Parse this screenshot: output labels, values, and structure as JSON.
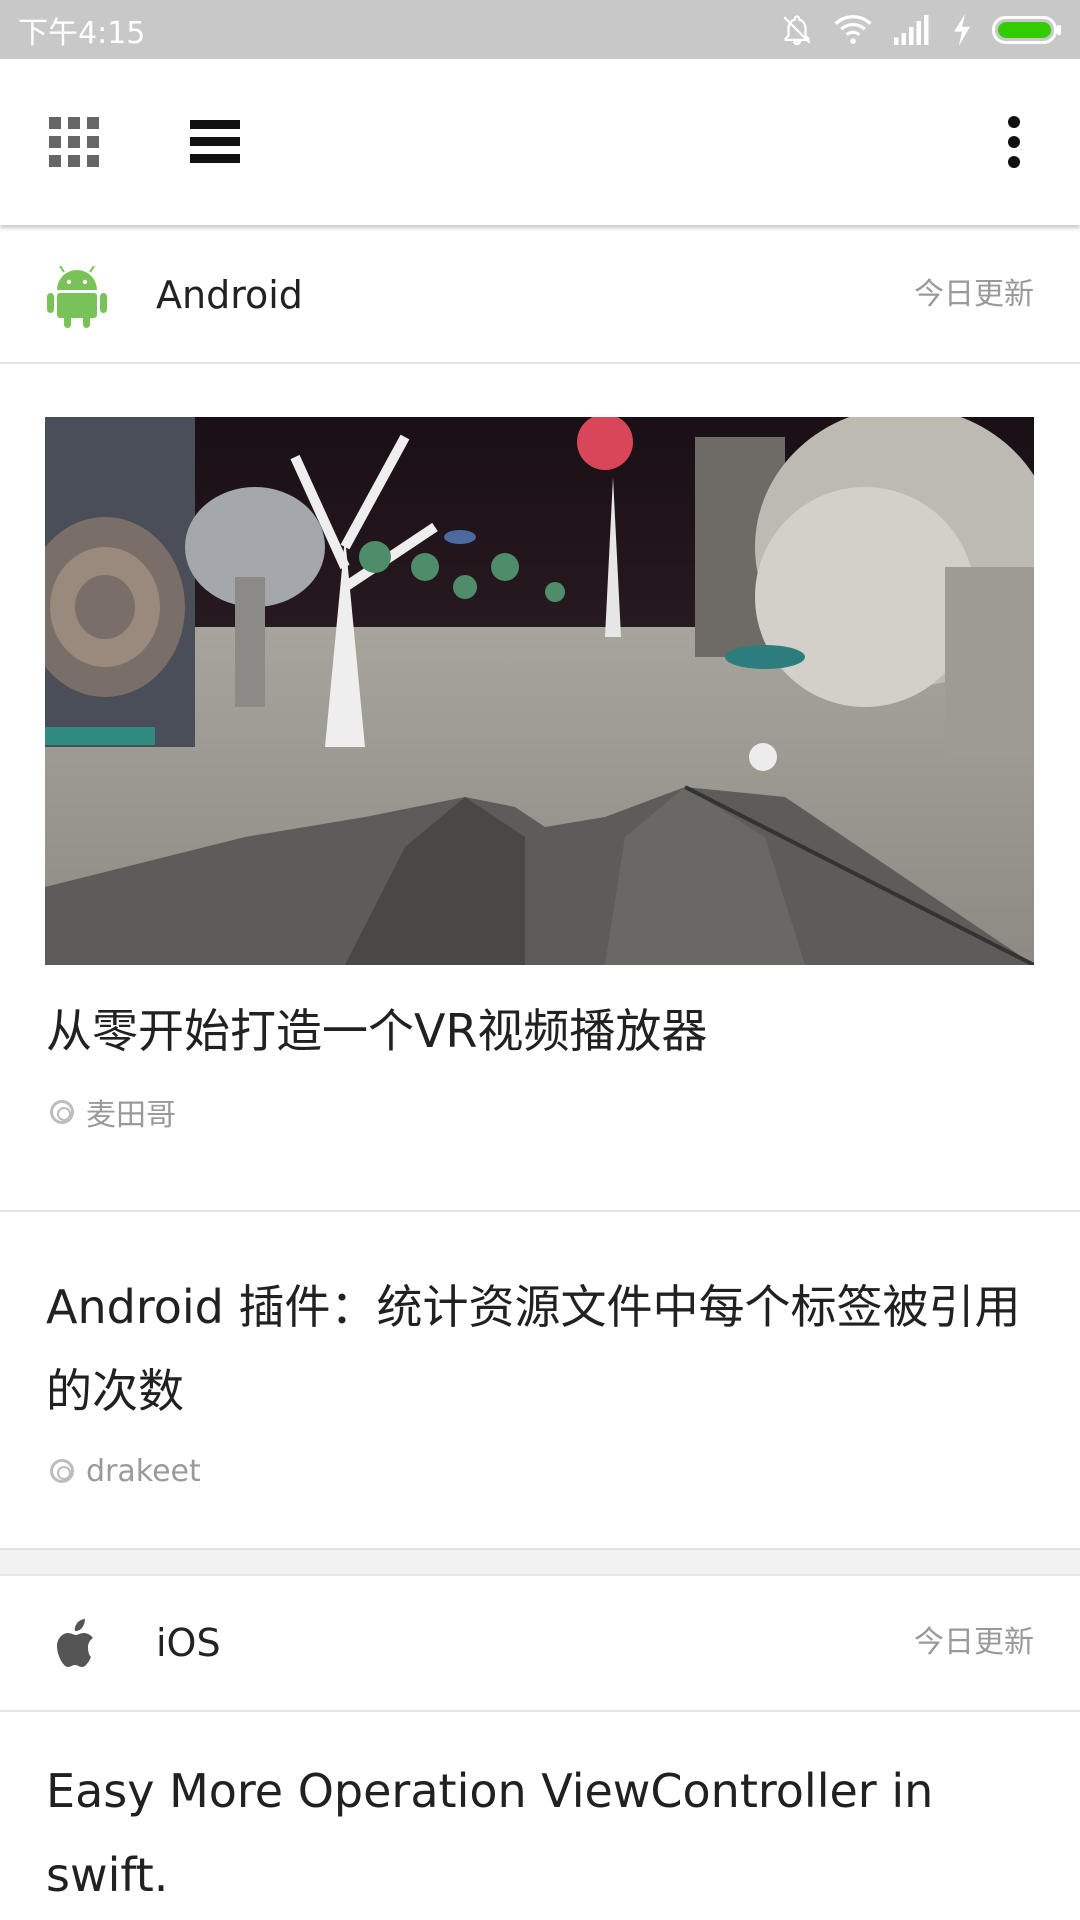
{
  "status_bar": {
    "time": "下午4:15",
    "icons": [
      "bell-off-icon",
      "wifi-icon",
      "signal-icon",
      "charging-icon",
      "battery-icon"
    ],
    "battery_color": "#33cc00"
  },
  "app_bar": {
    "icons": [
      "grid-icon",
      "menu-icon",
      "more-vert-icon"
    ]
  },
  "sections": [
    {
      "name": "Android",
      "update_label": "今日更新",
      "icon": "android-icon",
      "icon_color": "#78c257",
      "articles": [
        {
          "title": "从零开始打造一个VR视频播放器",
          "author": "麦田哥",
          "has_image": true
        },
        {
          "title": "Android 插件：统计资源文件中每个标签被引用的次数",
          "author": "drakeet",
          "has_image": false
        }
      ]
    },
    {
      "name": "iOS",
      "update_label": "今日更新",
      "icon": "apple-icon",
      "icon_color": "#555555",
      "articles": [
        {
          "title": "Easy More Operation ViewController in swift."
        }
      ]
    }
  ]
}
